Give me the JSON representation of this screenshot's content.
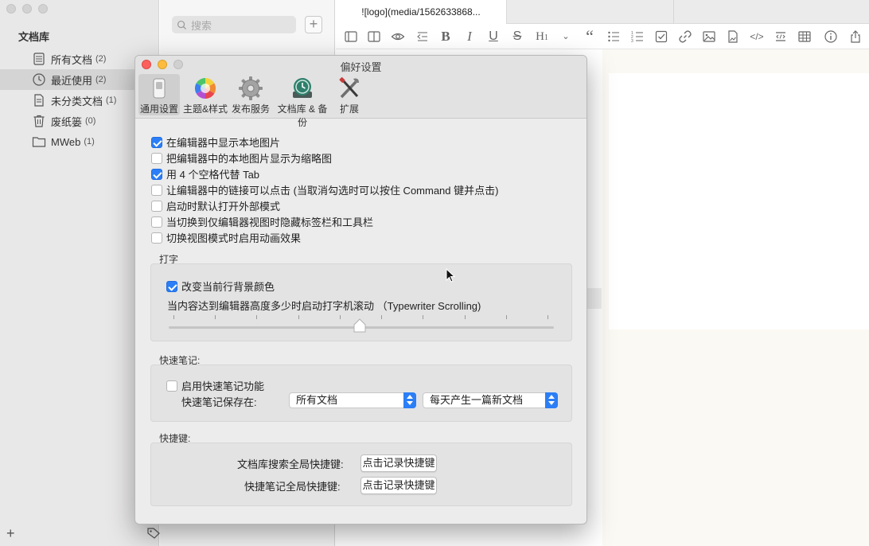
{
  "sidebar": {
    "title": "文档库",
    "items": [
      {
        "label": "所有文档",
        "count": "(2)",
        "icon": "stack-docs-icon"
      },
      {
        "label": "最近使用",
        "count": "(2)",
        "icon": "clock-icon"
      },
      {
        "label": "未分类文档",
        "count": "(1)",
        "icon": "document-icon"
      },
      {
        "label": "废纸篓",
        "count": "(0)",
        "icon": "trash-icon"
      },
      {
        "label": "MWeb",
        "count": "(1)",
        "icon": "folder-icon"
      }
    ],
    "active_index": 1
  },
  "doclist": {
    "search_placeholder": "搜索"
  },
  "editor": {
    "tab_title": "![logo](media/1562633868..."
  },
  "prefs": {
    "title": "偏好设置",
    "tabs": [
      {
        "label": "通用设置",
        "icon": "switch-icon"
      },
      {
        "label": "主题&样式",
        "icon": "color-wheel-icon"
      },
      {
        "label": "发布服务",
        "icon": "gear-icon"
      },
      {
        "label": "文档库 & 备份",
        "icon": "time-machine-icon"
      },
      {
        "label": "扩展",
        "icon": "tools-icon"
      }
    ],
    "general": [
      {
        "label": "在编辑器中显示本地图片",
        "checked": true
      },
      {
        "label": "把编辑器中的本地图片显示为缩略图",
        "checked": false
      },
      {
        "label": "用 4 个空格代替 Tab",
        "checked": true
      },
      {
        "label": "让编辑器中的链接可以点击 (当取消勾选时可以按住 Command 键并点击)",
        "checked": false
      },
      {
        "label": "启动时默认打开外部模式",
        "checked": false
      },
      {
        "label": "当切换到仅编辑器视图时隐藏标签栏和工具栏",
        "checked": false
      },
      {
        "label": "切换视图模式时启用动画效果",
        "checked": false
      }
    ],
    "typing": {
      "section": "打字",
      "highlight_label": "改变当前行背景颜色",
      "highlight_checked": true,
      "scroll_label": "当内容达到编辑器高度多少时启动打字机滚动 （Typewriter Scrolling)",
      "slider_value": 0.5
    },
    "quicknote": {
      "section": "快速笔记:",
      "enable_label": "启用快速笔记功能",
      "enable_checked": false,
      "save_label": "快速笔记保存在:",
      "save_target": "所有文档",
      "save_mode": "每天产生一篇新文档"
    },
    "shortcuts": {
      "section": "快捷键:",
      "search_label": "文档库搜索全局快捷键:",
      "note_label": "快捷笔记全局快捷键:",
      "record_button": "点击记录快捷键"
    }
  },
  "colors": {
    "accent": "#2b7ef6",
    "close": "#fc605c",
    "minimize": "#fdbc40"
  }
}
